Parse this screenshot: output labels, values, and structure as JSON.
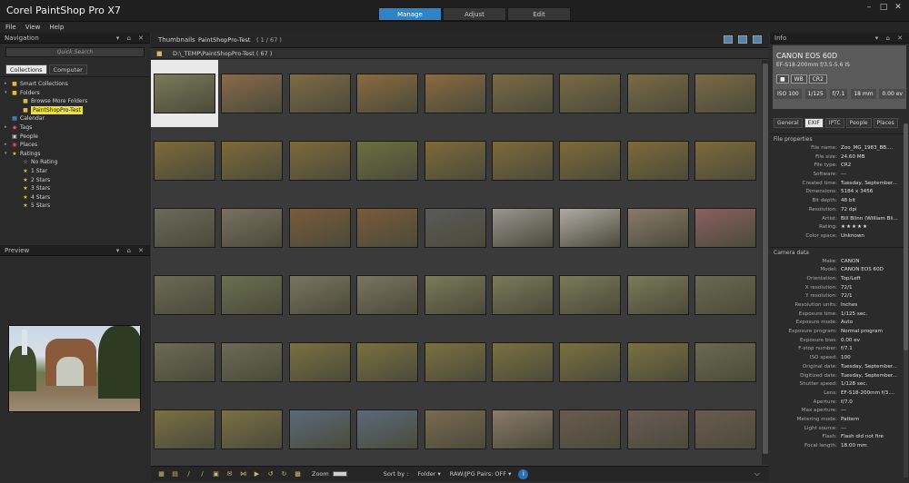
{
  "app": {
    "title": "Corel PaintShop Pro X7"
  },
  "modes": [
    {
      "label": "Manage",
      "active": true
    },
    {
      "label": "Adjust",
      "active": false
    },
    {
      "label": "Edit",
      "active": false
    }
  ],
  "window_buttons": [
    "–",
    "□",
    "✕"
  ],
  "menu": [
    "File",
    "View",
    "Help"
  ],
  "navigation": {
    "title": "Navigation",
    "header_buttons": "▾ ⌂ ✕",
    "search_placeholder": "Quick Search",
    "tabs": [
      {
        "label": "Collections",
        "active": true
      },
      {
        "label": "Computer",
        "active": false
      }
    ],
    "tree": [
      {
        "label": "Smart Collections",
        "icon": "folder-icon",
        "glyph": "■",
        "cls": "folder",
        "indent": 0,
        "arrow": "▸"
      },
      {
        "label": "Folders",
        "icon": "folder-icon",
        "glyph": "■",
        "cls": "folder",
        "indent": 0,
        "arrow": "▾"
      },
      {
        "label": "Browse More Folders",
        "icon": "folder-icon",
        "glyph": "■",
        "cls": "folder",
        "indent": 2,
        "arrow": ""
      },
      {
        "label": "PaintShopPro-Test",
        "icon": "folder-icon",
        "glyph": "■",
        "cls": "folder",
        "indent": 2,
        "arrow": "",
        "selected": true
      },
      {
        "label": "Calendar",
        "icon": "calendar-icon",
        "glyph": "▦",
        "cls": "blue",
        "indent": 0,
        "arrow": ""
      },
      {
        "label": "Tags",
        "icon": "tag-icon",
        "glyph": "◆",
        "cls": "red",
        "indent": 0,
        "arrow": "▸"
      },
      {
        "label": "People",
        "icon": "people-icon",
        "glyph": "▣",
        "cls": "gray",
        "indent": 0,
        "arrow": ""
      },
      {
        "label": "Places",
        "icon": "places-icon",
        "glyph": "◉",
        "cls": "red",
        "indent": 0,
        "arrow": "▸"
      },
      {
        "label": "Ratings",
        "icon": "star-icon",
        "glyph": "★",
        "cls": "star",
        "indent": 0,
        "arrow": "▾"
      },
      {
        "label": "No Rating",
        "icon": "star-outline-icon",
        "glyph": "☆",
        "cls": "gray",
        "indent": 2,
        "arrow": ""
      },
      {
        "label": "1 Star",
        "icon": "star-icon",
        "glyph": "★",
        "cls": "star",
        "indent": 2,
        "arrow": ""
      },
      {
        "label": "2 Stars",
        "icon": "star-icon",
        "glyph": "★",
        "cls": "star",
        "indent": 2,
        "arrow": ""
      },
      {
        "label": "3 Stars",
        "icon": "star-icon",
        "glyph": "★",
        "cls": "star",
        "indent": 2,
        "arrow": ""
      },
      {
        "label": "4 Stars",
        "icon": "star-icon",
        "glyph": "★",
        "cls": "star",
        "indent": 2,
        "arrow": ""
      },
      {
        "label": "5 Stars",
        "icon": "star-icon",
        "glyph": "★",
        "cls": "star",
        "indent": 2,
        "arrow": ""
      }
    ]
  },
  "preview": {
    "title": "Preview",
    "header_buttons": "▾ ⌂ ✕"
  },
  "thumbnails": {
    "title": "Thumbnails",
    "folder_name": "PaintShopPro-Test",
    "count": "( 1 / 67 )",
    "path": "D:\\_TEMP\\PaintShopPro-Test ( 67 )",
    "rows": [
      {
        "colors": [
          "#7a7a5a",
          "#8a6a4a",
          "#7f6a45",
          "#8a6a40",
          "#8a6a40",
          "#7a6a45",
          "#7a6a45",
          "#7a6a45",
          "#7a6a45"
        ]
      },
      {
        "colors": [
          "#7e6a3a",
          "#7e6a3a",
          "#7e6a3a",
          "#6a7040",
          "#7e6a3a",
          "#7e6a3a",
          "#7e6a3a",
          "#7e6a3a",
          "#7e6a3a"
        ]
      },
      {
        "colors": [
          "#6a6a5a",
          "#7a7060",
          "#7a5a3a",
          "#7a5a3a",
          "#5a5a5a",
          "#9a9590",
          "#b0aba5",
          "#8a7a6a",
          "#8a6060"
        ]
      },
      {
        "colors": [
          "#6a6a55",
          "#6a7050",
          "#7a7560",
          "#7a7560",
          "#7a7a5a",
          "#7a7a5a",
          "#7a7a5a",
          "#7a7a5a",
          "#6a6a50"
        ]
      },
      {
        "colors": [
          "#6a6a55",
          "#6a6a55",
          "#7a7040",
          "#7a7040",
          "#7a7040",
          "#7a7040",
          "#7a7040",
          "#7a7040",
          "#6a6a50"
        ]
      },
      {
        "colors": [
          "#7a7045",
          "#7a7045",
          "#5a6a7a",
          "#5a6a7a",
          "#7a6a50",
          "#8a7a6a",
          "#6a5a50",
          "#6a5a55",
          "#6a5a50"
        ]
      }
    ]
  },
  "bottom_bar": {
    "zoom_label": "Zoom",
    "sort_label": "Sort by :",
    "sort_value": "Folder ▾",
    "raw_label": "RAW/JPG Pairs: OFF ▾",
    "info_glyph": "i",
    "chevron": "⌵"
  },
  "info": {
    "title": "Info",
    "header_buttons": "▾ ⌂ ✕",
    "camera": "CANON EOS 60D",
    "lens": "EF-S18-200mm f/3.5-5.6 IS",
    "badges": [
      "■",
      "WB",
      "CR2"
    ],
    "stats": [
      "ISO 100",
      "1/125",
      "f/7.1",
      "18 mm",
      "0.00 ev"
    ],
    "tabs": [
      {
        "label": "General",
        "active": false
      },
      {
        "label": "EXIF",
        "active": true
      },
      {
        "label": "IPTC",
        "active": false
      },
      {
        "label": "People",
        "active": false
      },
      {
        "label": "Places",
        "active": false
      }
    ],
    "file_section": "File properties",
    "file_props": [
      {
        "k": "File name:",
        "v": "Zoo_MG_1983_BB...."
      },
      {
        "k": "File size:",
        "v": "24.60 MB"
      },
      {
        "k": "File type:",
        "v": "CR2"
      },
      {
        "k": "Software:",
        "v": "---"
      },
      {
        "k": "Created time:",
        "v": "Tuesday, September..."
      },
      {
        "k": "Dimensions:",
        "v": "5184 x 3456"
      },
      {
        "k": "Bit depth:",
        "v": "48 bit"
      },
      {
        "k": "Resolution:",
        "v": "72 dpi"
      },
      {
        "k": "Artist:",
        "v": "Bill Blinn (William Bli..."
      },
      {
        "k": "Rating:",
        "v": "★★★★★"
      },
      {
        "k": "Color space:",
        "v": "Unknown"
      }
    ],
    "camera_section": "Camera data",
    "camera_props": [
      {
        "k": "Make:",
        "v": "CANON"
      },
      {
        "k": "Model:",
        "v": "CANON EOS 60D"
      },
      {
        "k": "Orientation:",
        "v": "Top/Left"
      },
      {
        "k": "X resolution:",
        "v": "72/1"
      },
      {
        "k": "Y resolution:",
        "v": "72/1"
      },
      {
        "k": "Resolution units:",
        "v": "Inches"
      },
      {
        "k": "Exposure time:",
        "v": "1/125 sec."
      },
      {
        "k": "Exposure mode:",
        "v": "Auto"
      },
      {
        "k": "Exposure program:",
        "v": "Normal program"
      },
      {
        "k": "Exposure bias:",
        "v": "0.00 ev"
      },
      {
        "k": "F-stop number:",
        "v": "f/7.1"
      },
      {
        "k": "ISO speed:",
        "v": "100"
      },
      {
        "k": "Original date:",
        "v": "Tuesday, September..."
      },
      {
        "k": "Digitized date:",
        "v": "Tuesday, September..."
      },
      {
        "k": "Shutter speed:",
        "v": "1/128 sec."
      },
      {
        "k": "Lens:",
        "v": "EF-S18-200mm f/3...."
      },
      {
        "k": "Aperture:",
        "v": "f/7.0"
      },
      {
        "k": "Max aperture:",
        "v": "---"
      },
      {
        "k": "Metering mode:",
        "v": "Pattern"
      },
      {
        "k": "Light source:",
        "v": "---"
      },
      {
        "k": "Flash:",
        "v": "Flash did not fire"
      },
      {
        "k": "Focal length:",
        "v": "18.00 mm"
      }
    ]
  }
}
